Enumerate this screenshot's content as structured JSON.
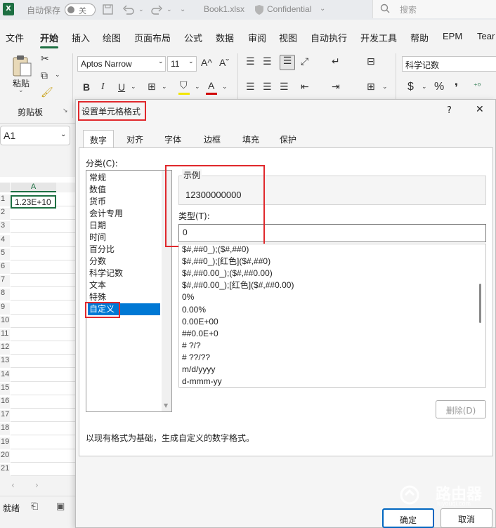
{
  "window": {
    "autosave_label": "自动保存",
    "autosave_state": "关",
    "file_name": "Book1.xlsx",
    "sensitivity_label": "Confidential",
    "search_placeholder": "搜索",
    "app_icon_letter": "X"
  },
  "menu": {
    "items": [
      "文件",
      "开始",
      "插入",
      "绘图",
      "页面布局",
      "公式",
      "数据",
      "审阅",
      "视图",
      "自动执行",
      "开发工具",
      "帮助",
      "EPM",
      "Tear"
    ]
  },
  "ribbon": {
    "paste_label": "粘贴",
    "clipboard_group": "剪贴板",
    "font_name": "Aptos Narrow",
    "font_size": "11",
    "grow_font": "A^",
    "shrink_font": "Aˇ",
    "bold": "B",
    "italic": "I",
    "underline": "U",
    "number_format": "科学记数",
    "currency": "$",
    "percent": "%",
    "comma": "❜"
  },
  "sheet": {
    "name_box": "A1",
    "column_header": "A",
    "row_numbers": [
      "1",
      "2",
      "3",
      "4",
      "5",
      "6",
      "7",
      "8",
      "9",
      "10",
      "11",
      "12",
      "13",
      "14",
      "15",
      "16",
      "17",
      "18",
      "19",
      "20",
      "21"
    ],
    "cell_a1": "1.23E+10",
    "status": "就绪"
  },
  "dialog": {
    "title": "设置单元格格式",
    "help": "?",
    "close": "✕",
    "tabs": [
      "数字",
      "对齐",
      "字体",
      "边框",
      "填充",
      "保护"
    ],
    "category_label": "分类(C):",
    "categories": [
      "常规",
      "数值",
      "货币",
      "会计专用",
      "日期",
      "时间",
      "百分比",
      "分数",
      "科学记数",
      "文本",
      "特殊",
      "自定义"
    ],
    "sample_label": "示例",
    "sample_value": "12300000000",
    "type_label": "类型(T):",
    "type_value": "0",
    "formats": [
      "$#,##0_);($#,##0)",
      "$#,##0_);[红色]($#,##0)",
      "$#,##0.00_);($#,##0.00)",
      "$#,##0.00_);[红色]($#,##0.00)",
      "0%",
      "0.00%",
      "0.00E+00",
      "##0.0E+0",
      "# ?/?",
      "# ??/??",
      "m/d/yyyy",
      "d-mmm-yy"
    ],
    "delete_button": "删除(D)",
    "description": "以现有格式为基础，生成自定义的数字格式。",
    "ok_button": "确定",
    "cancel_button": "取消"
  },
  "watermark": {
    "name": "路由器",
    "url": "luyouqi.com"
  },
  "colors": {
    "excel_green": "#1d6f42",
    "selection_blue": "#0078d4",
    "highlight_red": "#e0282c"
  }
}
